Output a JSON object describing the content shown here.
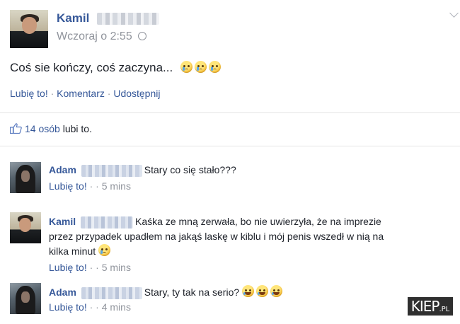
{
  "post": {
    "author": "Kamil",
    "timestamp": "Wczoraj o 2:55",
    "text": "Coś sie kończy, coś zaczyna...",
    "actions": {
      "like": "Lubię to!",
      "comment": "Komentarz",
      "share": "Udostępnij",
      "separator": "·"
    },
    "likes_count": "14 osób",
    "likes_suffix": "lubi to."
  },
  "comments": [
    {
      "author": "Adam",
      "text": "Stary co się stało???",
      "like": "Lubię to!",
      "dot": "·",
      "time": "· 5 mins"
    },
    {
      "author": "Kamil",
      "text_line1": "Kaśka ze mną zerwała, bo nie uwierzyła, że na imprezie",
      "text_line2": "przez przypadek upadłem na jakąś laskę w kiblu i mój penis wszedł w nią na",
      "text_line3": "kilka minut",
      "like": "Lubię to!",
      "dot": "·",
      "time": "· 5 mins"
    },
    {
      "author": "Adam",
      "text": "Stary, ty tak na serio?",
      "like": "Lubię to!",
      "dot": "·",
      "time": "· 4 mins"
    }
  ],
  "watermark": {
    "main": "KIEP",
    "suffix": ".PL"
  },
  "colors": {
    "link": "#365899",
    "text": "#1d2129",
    "meta": "#90949c"
  }
}
